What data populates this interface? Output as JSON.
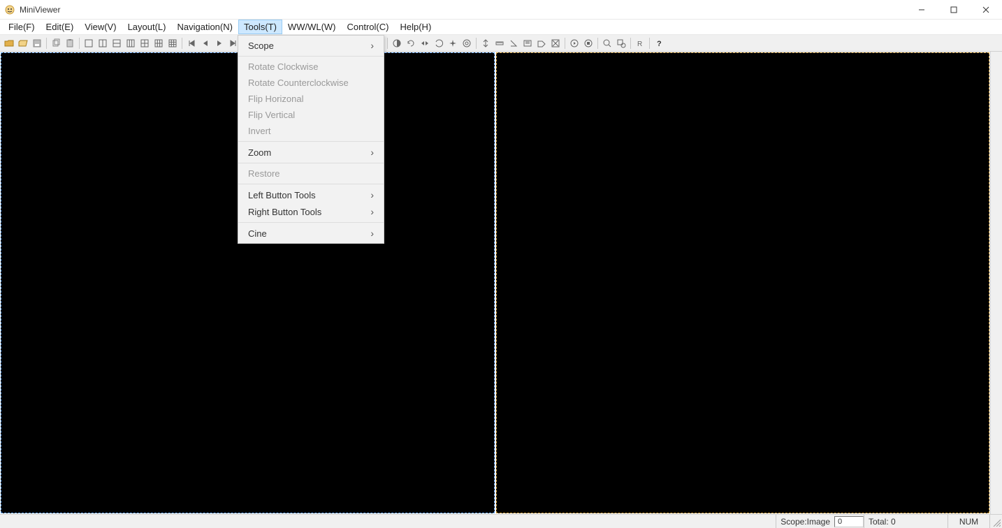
{
  "title": "MiniViewer",
  "menu": {
    "items": [
      {
        "label": "File(F)"
      },
      {
        "label": "Edit(E)"
      },
      {
        "label": "View(V)"
      },
      {
        "label": "Layout(L)"
      },
      {
        "label": "Navigation(N)"
      },
      {
        "label": "Tools(T)",
        "active": true
      },
      {
        "label": "WW/WL(W)"
      },
      {
        "label": "Control(C)"
      },
      {
        "label": "Help(H)"
      }
    ]
  },
  "tools_menu": {
    "scope": "Scope",
    "rotate_cw": "Rotate Clockwise",
    "rotate_ccw": "Rotate Counterclockwise",
    "flip_h": "Flip Horizonal",
    "flip_v": "Flip Vertical",
    "invert": "Invert",
    "zoom": "Zoom",
    "restore": "Restore",
    "left_btn": "Left Button Tools",
    "right_btn": "Right Button Tools",
    "cine": "Cine"
  },
  "status": {
    "scope_label": "Scope:Image",
    "scope_value": "0",
    "total_label": "Total: 0",
    "num": "NUM"
  }
}
